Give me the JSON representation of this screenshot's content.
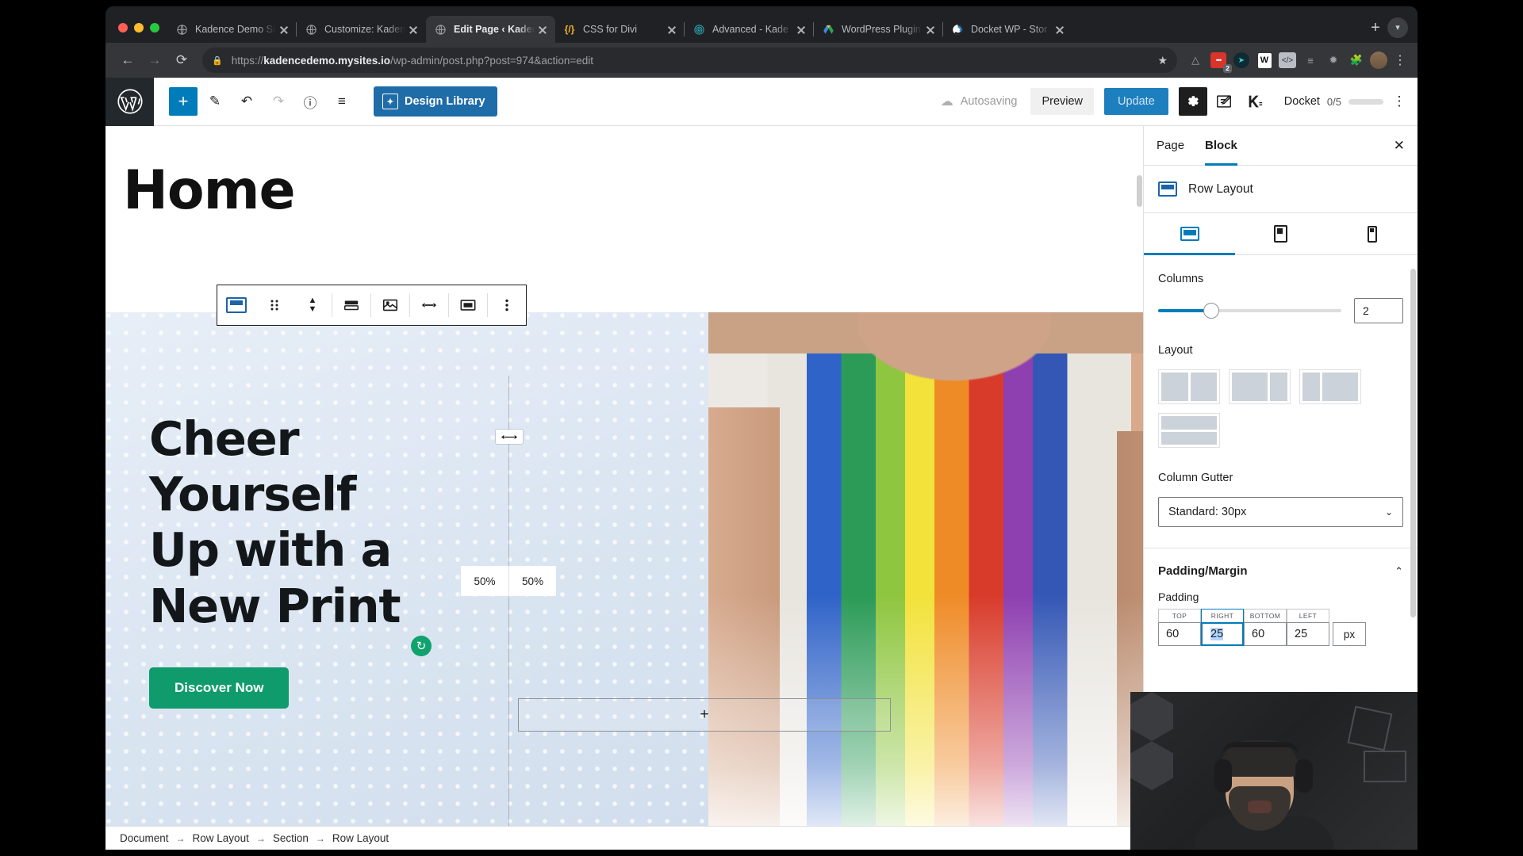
{
  "browser": {
    "tabs": [
      {
        "title": "Kadence Demo Si",
        "favicon": "globe-icon",
        "active": false
      },
      {
        "title": "Customize: Kaden",
        "favicon": "globe-icon",
        "active": false
      },
      {
        "title": "Edit Page ‹ Kaden",
        "favicon": "globe-icon",
        "active": true
      },
      {
        "title": "CSS for Divi",
        "favicon": "code-icon",
        "active": false
      },
      {
        "title": "Advanced - Kade",
        "favicon": "spiral-icon",
        "active": false
      },
      {
        "title": "WordPress Plugin",
        "favicon": "google-drive-icon",
        "active": false
      },
      {
        "title": "Docket WP - Stor",
        "favicon": "docket-icon",
        "active": false
      }
    ],
    "new_tab_label": "+",
    "window_menu_label": "▾",
    "nav": {
      "back": "←",
      "forward": "→",
      "reload": "⟳"
    },
    "omnibox": {
      "lock_icon": "lock-icon",
      "url_scheme": "https://",
      "url_host": "kadencedemo.mysites.io",
      "url_path": "/wp-admin/post.php?post=974&action=edit",
      "star_icon": "★"
    },
    "extensions": [
      {
        "name": "drive-extension-icon",
        "glyph": "△",
        "badge": ""
      },
      {
        "name": "todoist-extension-icon",
        "glyph": "•••",
        "badge": "2"
      },
      {
        "name": "navigation-extension-icon",
        "glyph": "➤",
        "badge": ""
      },
      {
        "name": "notes-extension-icon",
        "glyph": "W",
        "badge": ""
      },
      {
        "name": "code-extension-icon",
        "glyph": "</>",
        "badge": ""
      },
      {
        "name": "list-extension-icon",
        "glyph": "≡",
        "badge": ""
      },
      {
        "name": "colorzilla-extension-icon",
        "glyph": "✹",
        "badge": ""
      },
      {
        "name": "puzzle-extension-icon",
        "glyph": "🧩",
        "badge": ""
      }
    ],
    "profile_avatar": "avatar",
    "chrome_menu": "⋮"
  },
  "editor": {
    "header": {
      "wp_logo": "wordpress-logo",
      "tools": [
        {
          "name": "add-block-button",
          "glyph": "+"
        },
        {
          "name": "edit-tool-button",
          "glyph": "✎"
        },
        {
          "name": "undo-button",
          "glyph": "↶"
        },
        {
          "name": "redo-button",
          "glyph": "↷"
        },
        {
          "name": "details-info-button",
          "glyph": "ⓘ"
        },
        {
          "name": "list-view-button",
          "glyph": "≡"
        }
      ],
      "design_library_label": "Design Library",
      "autosaving_label": "Autosaving",
      "preview_label": "Preview",
      "update_label": "Update",
      "settings_gear": "gear-icon",
      "post_edit_icon": "post-edit-icon",
      "kadence_icon": "kadence-icon",
      "docket_label": "Docket",
      "docket_progress": "0/5",
      "more_menu": "⋮"
    },
    "canvas": {
      "post_title": "Home",
      "block_toolbar": [
        {
          "name": "row-layout-block-icon",
          "glyph": ""
        },
        {
          "name": "drag-handle-icon",
          "glyph": "⣿"
        },
        {
          "name": "move-up-down-icon",
          "glyph": ""
        },
        {
          "name": "row-settings-icon",
          "glyph": "▤"
        },
        {
          "name": "background-image-icon",
          "glyph": "🖼"
        },
        {
          "name": "width-align-icon",
          "glyph": "↔"
        },
        {
          "name": "section-align-icon",
          "glyph": "▭"
        },
        {
          "name": "more-options-icon",
          "glyph": "⋮"
        }
      ],
      "hero": {
        "heading_lines": [
          "Cheer",
          "Yourself",
          "Up with a",
          "New Print"
        ],
        "button_label": "Discover Now",
        "column_widths": [
          "50%",
          "50%"
        ],
        "resize_grip_icon": "horizontal-resize-icon",
        "rotate_icon": "reset-rotate-icon",
        "add_block_placeholder": "+"
      }
    },
    "breadcrumb": [
      "Document",
      "Row Layout",
      "Section",
      "Row Layout"
    ],
    "breadcrumb_separator": "→",
    "sidebar": {
      "tabs": [
        {
          "label": "Page",
          "active": false
        },
        {
          "label": "Block",
          "active": true
        }
      ],
      "close_label": "✕",
      "block_name": "Row Layout",
      "device_tabs": [
        {
          "name": "desktop-device-tab",
          "active": true
        },
        {
          "name": "tablet-device-tab",
          "active": false
        },
        {
          "name": "mobile-device-tab",
          "active": false
        }
      ],
      "columns_label": "Columns",
      "columns_value": "2",
      "layout_label": "Layout",
      "layout_options": [
        {
          "name": "layout-equal-halves",
          "cols": [
            1,
            1
          ]
        },
        {
          "name": "layout-left-wide",
          "cols": [
            2,
            1
          ]
        },
        {
          "name": "layout-right-wide",
          "cols": [
            1,
            2
          ]
        },
        {
          "name": "layout-stacked-rows",
          "cols": [
            1,
            1
          ],
          "vertical": true
        }
      ],
      "column_gutter_label": "Column Gutter",
      "column_gutter_value": "Standard: 30px",
      "padding_margin_label": "Padding/Margin",
      "padding_margin_collapse_icon": "chevron-up-icon",
      "padding_label": "Padding",
      "padding_fields": [
        {
          "cap": "TOP",
          "value": "60",
          "focused": false
        },
        {
          "cap": "RIGHT",
          "value": "25",
          "focused": true
        },
        {
          "cap": "BOTTOM",
          "value": "60",
          "focused": false
        },
        {
          "cap": "LEFT",
          "value": "25",
          "focused": false
        }
      ],
      "padding_unit": "px"
    }
  }
}
